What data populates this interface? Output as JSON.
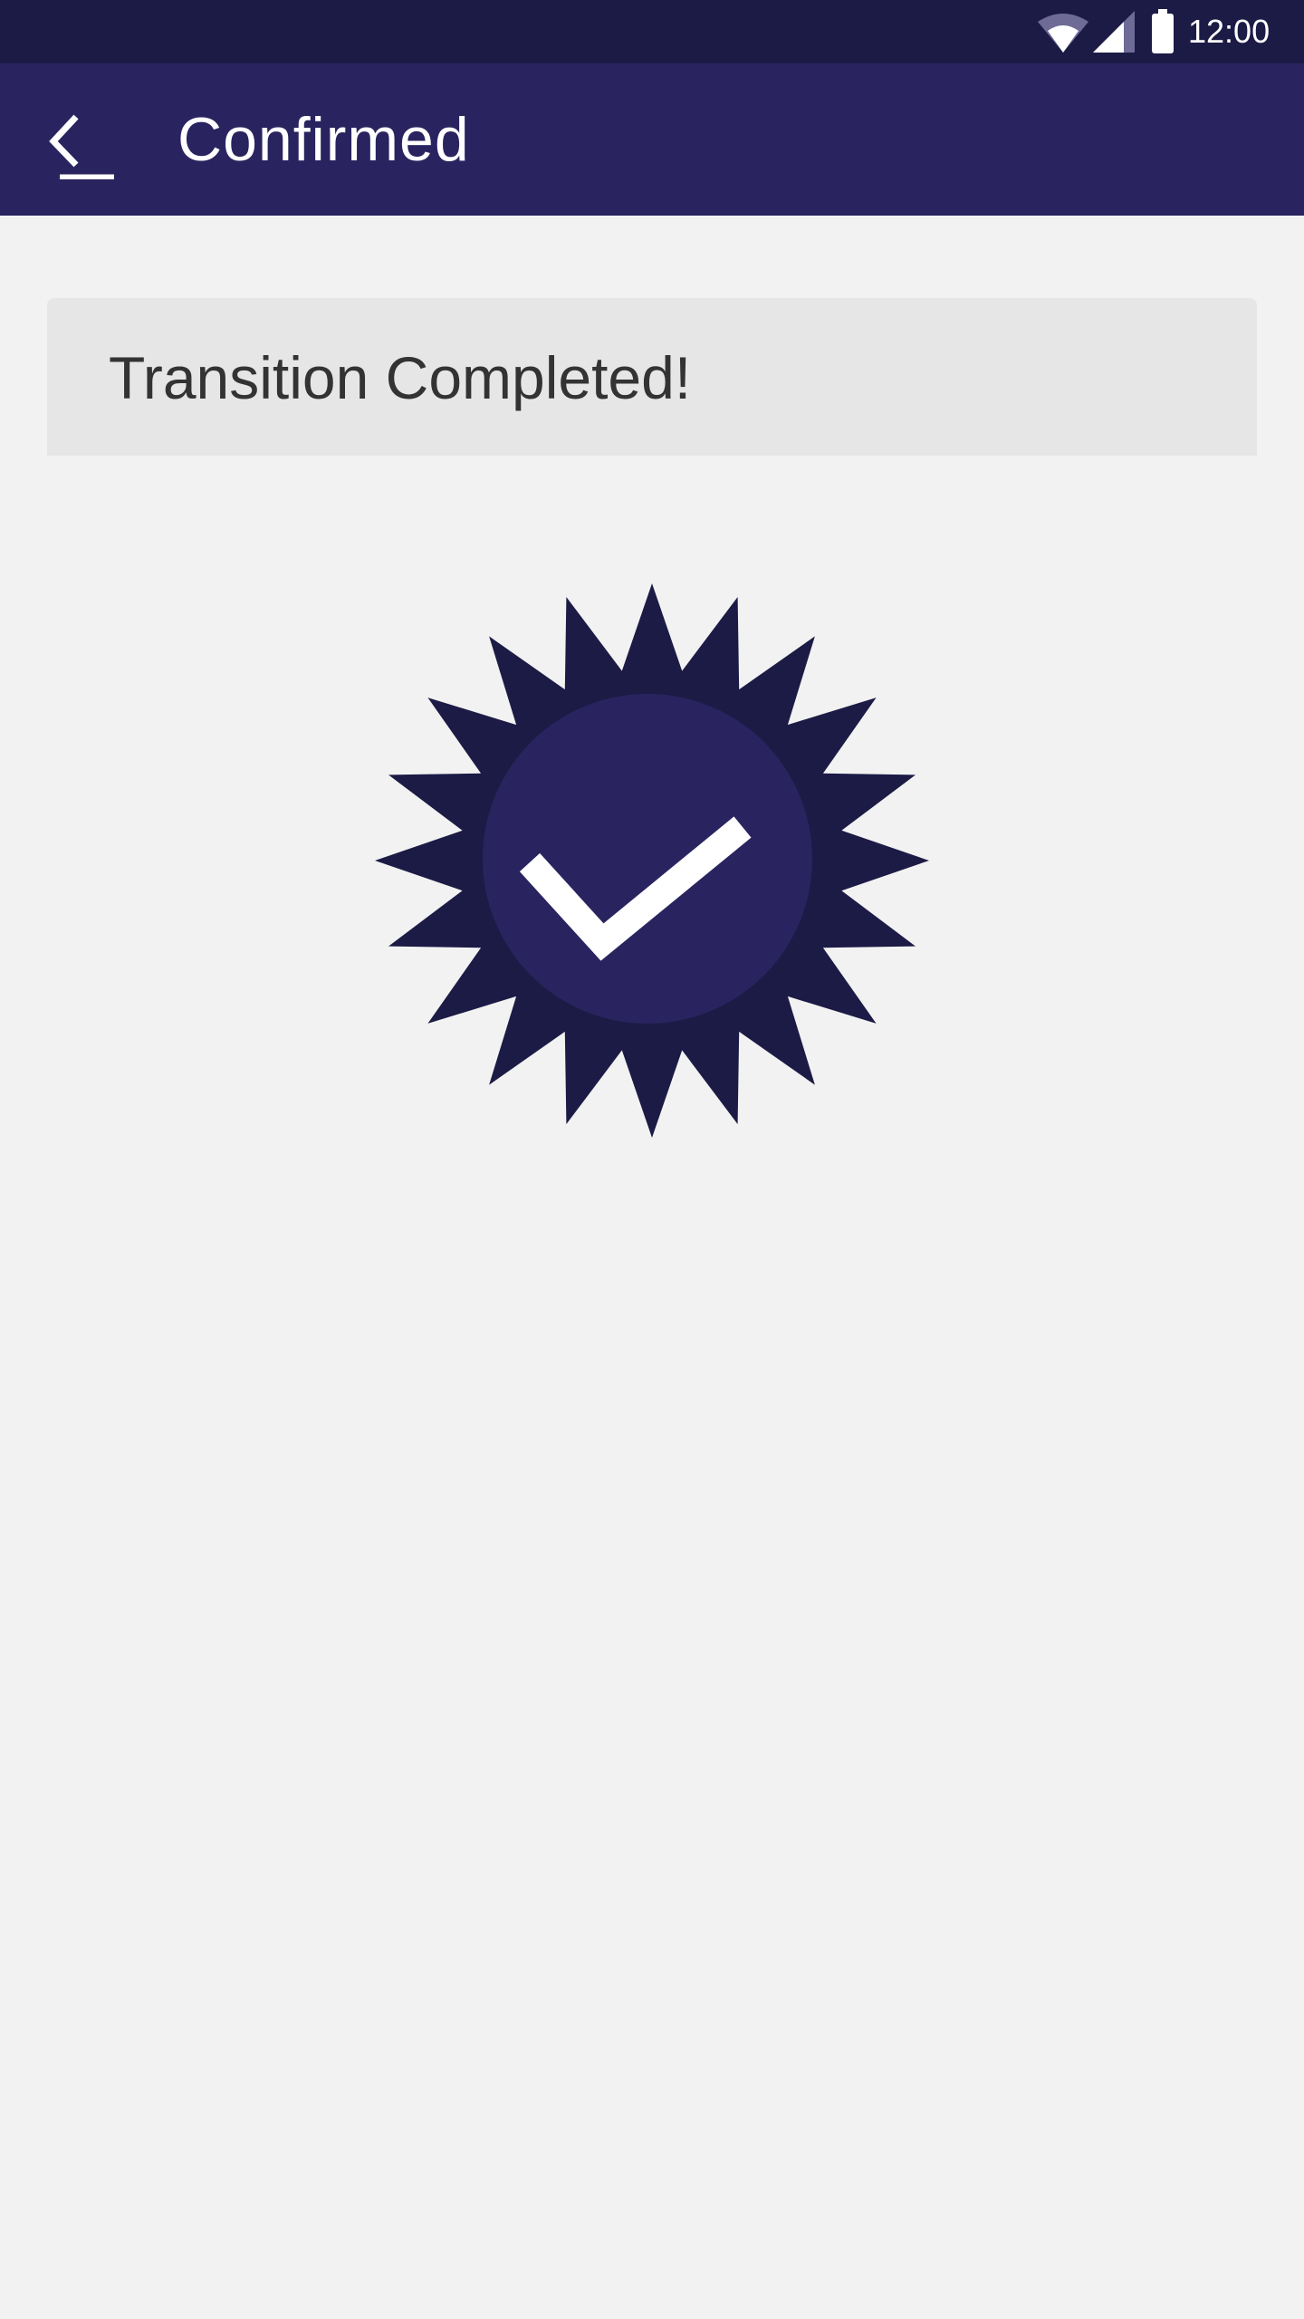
{
  "status_bar": {
    "time": "12:00",
    "icons": [
      "wifi-icon",
      "signal-icon",
      "battery-icon"
    ]
  },
  "app_bar": {
    "back_icon": "arrow-back-icon",
    "title": "Confirmed"
  },
  "message_card": {
    "text": "Transition Completed!"
  },
  "badge": {
    "icon": "verified-badge-icon",
    "colors": {
      "seal": "#1c1b46",
      "circle": "#29245f",
      "check": "#ffffff"
    }
  },
  "colors": {
    "status_bar": "#1c1b46",
    "app_bar": "#29245f",
    "background": "#f2f2f2",
    "card": "#e6e6e6",
    "text": "#333333"
  }
}
